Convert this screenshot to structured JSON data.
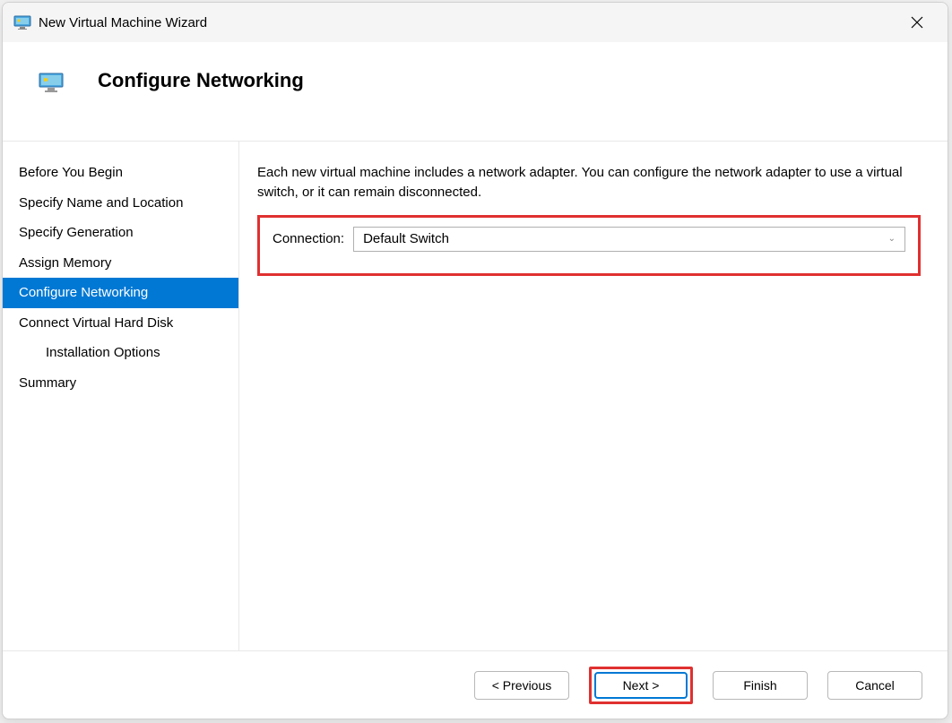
{
  "titlebar": {
    "title": "New Virtual Machine Wizard"
  },
  "header": {
    "title": "Configure Networking"
  },
  "sidebar": {
    "items": [
      {
        "label": "Before You Begin",
        "selected": false,
        "indented": false
      },
      {
        "label": "Specify Name and Location",
        "selected": false,
        "indented": false
      },
      {
        "label": "Specify Generation",
        "selected": false,
        "indented": false
      },
      {
        "label": "Assign Memory",
        "selected": false,
        "indented": false
      },
      {
        "label": "Configure Networking",
        "selected": true,
        "indented": false
      },
      {
        "label": "Connect Virtual Hard Disk",
        "selected": false,
        "indented": false
      },
      {
        "label": "Installation Options",
        "selected": false,
        "indented": true
      },
      {
        "label": "Summary",
        "selected": false,
        "indented": false
      }
    ]
  },
  "content": {
    "description": "Each new virtual machine includes a network adapter. You can configure the network adapter to use a virtual switch, or it can remain disconnected.",
    "connection_label": "Connection:",
    "connection_value": "Default Switch"
  },
  "footer": {
    "previous": "< Previous",
    "next": "Next >",
    "finish": "Finish",
    "cancel": "Cancel"
  }
}
